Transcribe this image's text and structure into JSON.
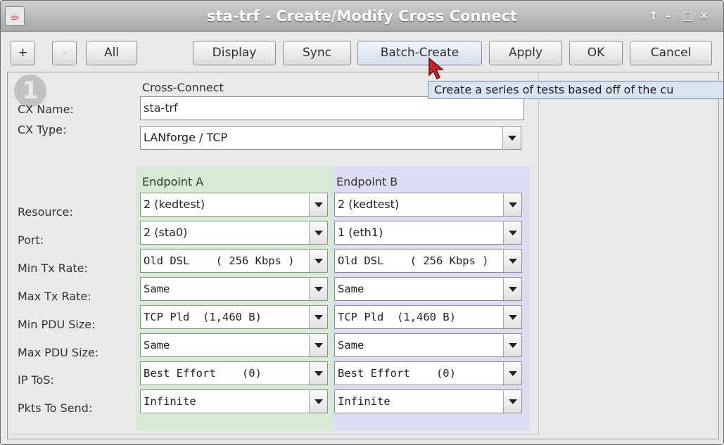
{
  "window": {
    "title": "sta-trf - Create/Modify Cross Connect",
    "app_icon": "java-cup-icon",
    "controls": {
      "up": "↑",
      "minimize": "–",
      "maximize": "□",
      "close": "✕"
    }
  },
  "toolbar": {
    "add": "+",
    "remove": "-",
    "all": "All",
    "display": "Display",
    "sync": "Sync",
    "batch_create": "Batch-Create",
    "apply": "Apply",
    "ok": "OK",
    "cancel": "Cancel"
  },
  "tooltip": "Create a series of tests based off of the cu",
  "form": {
    "step_number": "1",
    "section_title": "Cross-Connect",
    "cx_name_label": "CX Name:",
    "cx_name_value": "sta-trf",
    "cx_type_label": "CX Type:",
    "cx_type_value": "LANforge / TCP",
    "endpoint_a_header": "Endpoint A",
    "endpoint_b_header": "Endpoint B",
    "rows": [
      {
        "label": "Resource:",
        "a": "2 (kedtest)",
        "b": "2 (kedtest)"
      },
      {
        "label": "Port:",
        "a": "2 (sta0)",
        "b": "1 (eth1)"
      },
      {
        "label": "Min Tx Rate:",
        "a": "Old DSL    ( 256 Kbps )",
        "b": "Old DSL    ( 256 Kbps )"
      },
      {
        "label": "Max Tx Rate:",
        "a": "Same",
        "b": "Same"
      },
      {
        "label": "Min PDU Size:",
        "a": "TCP Pld  (1,460 B)",
        "b": "TCP Pld  (1,460 B)"
      },
      {
        "label": "Max PDU Size:",
        "a": "Same",
        "b": "Same"
      },
      {
        "label": "IP ToS:",
        "a": "Best Effort    (0)",
        "b": "Best Effort    (0)"
      },
      {
        "label": "Pkts To Send:",
        "a": "Infinite",
        "b": "Infinite"
      }
    ]
  },
  "colors": {
    "endpoint_a_bg": "#d6ead6",
    "endpoint_b_bg": "#dcdcf2",
    "tooltip_bg": "#d9e6f2",
    "cursor": "#c62828"
  }
}
